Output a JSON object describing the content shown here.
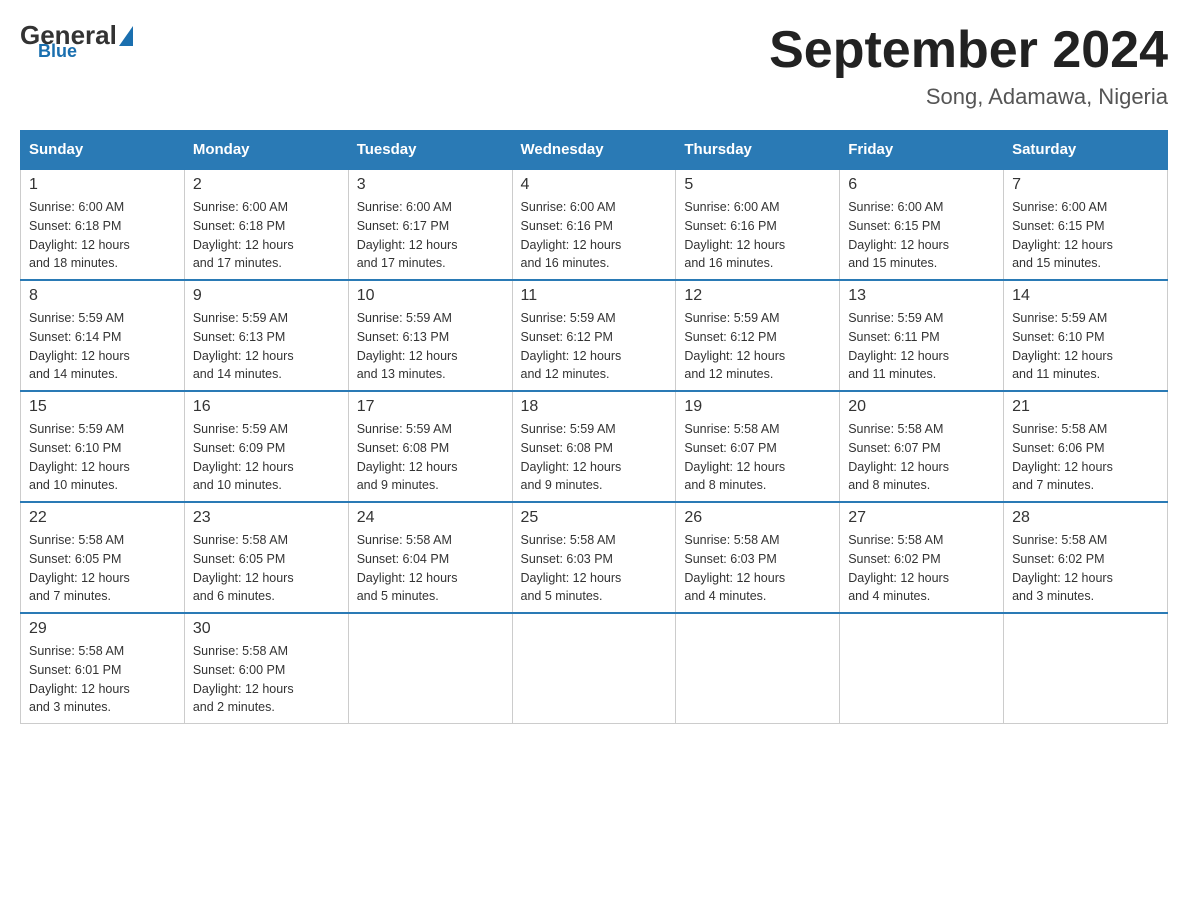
{
  "header": {
    "logo_general": "General",
    "logo_blue": "Blue",
    "month_title": "September 2024",
    "location": "Song, Adamawa, Nigeria"
  },
  "days_of_week": [
    "Sunday",
    "Monday",
    "Tuesday",
    "Wednesday",
    "Thursday",
    "Friday",
    "Saturday"
  ],
  "weeks": [
    [
      {
        "day": "1",
        "sunrise": "6:00 AM",
        "sunset": "6:18 PM",
        "daylight": "12 hours and 18 minutes."
      },
      {
        "day": "2",
        "sunrise": "6:00 AM",
        "sunset": "6:18 PM",
        "daylight": "12 hours and 17 minutes."
      },
      {
        "day": "3",
        "sunrise": "6:00 AM",
        "sunset": "6:17 PM",
        "daylight": "12 hours and 17 minutes."
      },
      {
        "day": "4",
        "sunrise": "6:00 AM",
        "sunset": "6:16 PM",
        "daylight": "12 hours and 16 minutes."
      },
      {
        "day": "5",
        "sunrise": "6:00 AM",
        "sunset": "6:16 PM",
        "daylight": "12 hours and 16 minutes."
      },
      {
        "day": "6",
        "sunrise": "6:00 AM",
        "sunset": "6:15 PM",
        "daylight": "12 hours and 15 minutes."
      },
      {
        "day": "7",
        "sunrise": "6:00 AM",
        "sunset": "6:15 PM",
        "daylight": "12 hours and 15 minutes."
      }
    ],
    [
      {
        "day": "8",
        "sunrise": "5:59 AM",
        "sunset": "6:14 PM",
        "daylight": "12 hours and 14 minutes."
      },
      {
        "day": "9",
        "sunrise": "5:59 AM",
        "sunset": "6:13 PM",
        "daylight": "12 hours and 14 minutes."
      },
      {
        "day": "10",
        "sunrise": "5:59 AM",
        "sunset": "6:13 PM",
        "daylight": "12 hours and 13 minutes."
      },
      {
        "day": "11",
        "sunrise": "5:59 AM",
        "sunset": "6:12 PM",
        "daylight": "12 hours and 12 minutes."
      },
      {
        "day": "12",
        "sunrise": "5:59 AM",
        "sunset": "6:12 PM",
        "daylight": "12 hours and 12 minutes."
      },
      {
        "day": "13",
        "sunrise": "5:59 AM",
        "sunset": "6:11 PM",
        "daylight": "12 hours and 11 minutes."
      },
      {
        "day": "14",
        "sunrise": "5:59 AM",
        "sunset": "6:10 PM",
        "daylight": "12 hours and 11 minutes."
      }
    ],
    [
      {
        "day": "15",
        "sunrise": "5:59 AM",
        "sunset": "6:10 PM",
        "daylight": "12 hours and 10 minutes."
      },
      {
        "day": "16",
        "sunrise": "5:59 AM",
        "sunset": "6:09 PM",
        "daylight": "12 hours and 10 minutes."
      },
      {
        "day": "17",
        "sunrise": "5:59 AM",
        "sunset": "6:08 PM",
        "daylight": "12 hours and 9 minutes."
      },
      {
        "day": "18",
        "sunrise": "5:59 AM",
        "sunset": "6:08 PM",
        "daylight": "12 hours and 9 minutes."
      },
      {
        "day": "19",
        "sunrise": "5:58 AM",
        "sunset": "6:07 PM",
        "daylight": "12 hours and 8 minutes."
      },
      {
        "day": "20",
        "sunrise": "5:58 AM",
        "sunset": "6:07 PM",
        "daylight": "12 hours and 8 minutes."
      },
      {
        "day": "21",
        "sunrise": "5:58 AM",
        "sunset": "6:06 PM",
        "daylight": "12 hours and 7 minutes."
      }
    ],
    [
      {
        "day": "22",
        "sunrise": "5:58 AM",
        "sunset": "6:05 PM",
        "daylight": "12 hours and 7 minutes."
      },
      {
        "day": "23",
        "sunrise": "5:58 AM",
        "sunset": "6:05 PM",
        "daylight": "12 hours and 6 minutes."
      },
      {
        "day": "24",
        "sunrise": "5:58 AM",
        "sunset": "6:04 PM",
        "daylight": "12 hours and 5 minutes."
      },
      {
        "day": "25",
        "sunrise": "5:58 AM",
        "sunset": "6:03 PM",
        "daylight": "12 hours and 5 minutes."
      },
      {
        "day": "26",
        "sunrise": "5:58 AM",
        "sunset": "6:03 PM",
        "daylight": "12 hours and 4 minutes."
      },
      {
        "day": "27",
        "sunrise": "5:58 AM",
        "sunset": "6:02 PM",
        "daylight": "12 hours and 4 minutes."
      },
      {
        "day": "28",
        "sunrise": "5:58 AM",
        "sunset": "6:02 PM",
        "daylight": "12 hours and 3 minutes."
      }
    ],
    [
      {
        "day": "29",
        "sunrise": "5:58 AM",
        "sunset": "6:01 PM",
        "daylight": "12 hours and 3 minutes."
      },
      {
        "day": "30",
        "sunrise": "5:58 AM",
        "sunset": "6:00 PM",
        "daylight": "12 hours and 2 minutes."
      },
      null,
      null,
      null,
      null,
      null
    ]
  ]
}
